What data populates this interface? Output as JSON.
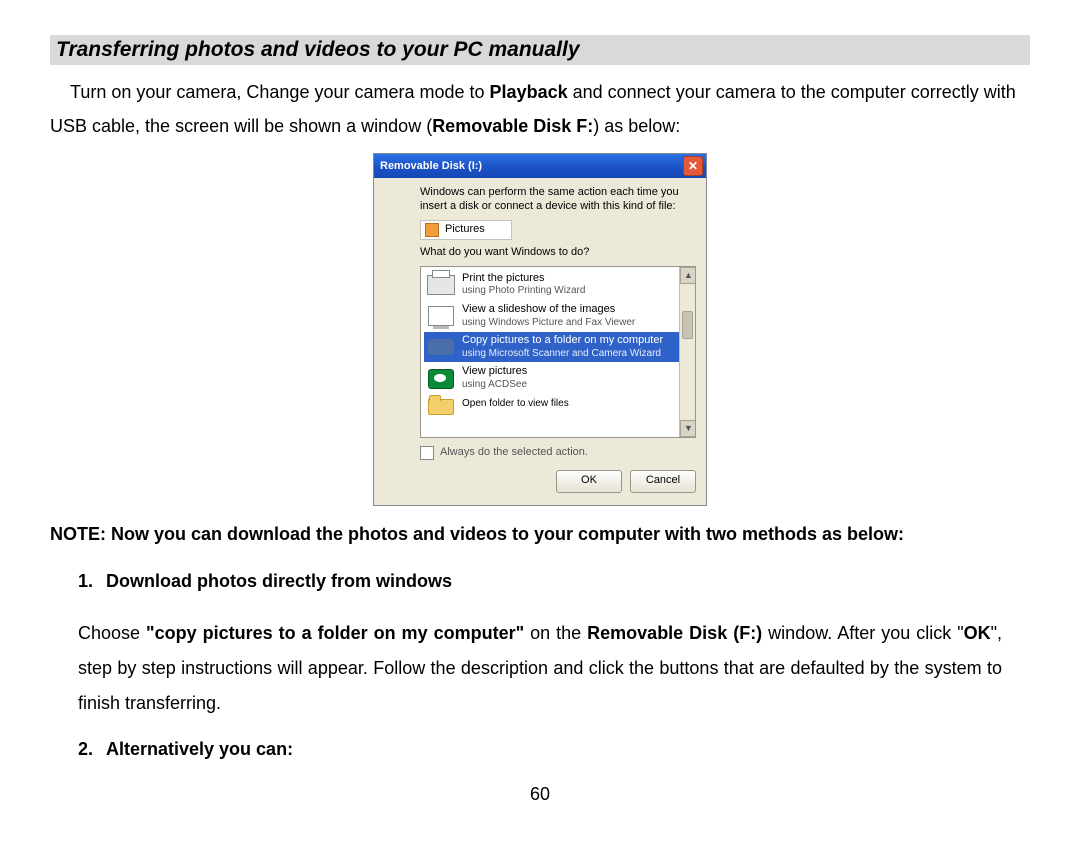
{
  "heading": "Transferring photos and videos to your PC manually",
  "intro": {
    "lead": "Turn on your camera, Change your camera mode to ",
    "bold1": "Playback",
    "mid": " and connect your camera to the computer correctly with USB cable, the screen will be shown a window (",
    "bold2": "Removable Disk F:",
    "tail": ") as below:"
  },
  "dialog": {
    "title": "Removable Disk (I:)",
    "close": "✕",
    "intro": "Windows can perform the same action each time you insert a disk or connect a device with this kind of file:",
    "pictures_label": "Pictures",
    "question": "What do you want Windows to do?",
    "options": [
      {
        "title": "Print the pictures",
        "sub": "using Photo Printing Wizard",
        "icon": "printer",
        "selected": false
      },
      {
        "title": "View a slideshow of the images",
        "sub": "using Windows Picture and Fax Viewer",
        "icon": "screen",
        "selected": false
      },
      {
        "title": "Copy pictures to a folder on my computer",
        "sub": "using Microsoft Scanner and Camera Wizard",
        "icon": "camera",
        "selected": true
      },
      {
        "title": "View pictures",
        "sub": "using ACDSee",
        "icon": "eye",
        "selected": false
      }
    ],
    "folder_option": "Open folder to view files",
    "always": "Always do the selected action.",
    "ok": "OK",
    "cancel": "Cancel"
  },
  "note": "NOTE: Now you can download the photos and videos to your computer with two methods as below:",
  "item1": {
    "num": "1.",
    "text": "Download photos directly from windows"
  },
  "para1": {
    "pre": "Choose ",
    "q1": "\"copy pictures to a folder on my computer\"",
    "mid1": " on the ",
    "b1": "Removable Disk (F:)",
    "mid2": " window.    After you click \"",
    "b2": "OK",
    "post": "\", step by step instructions will appear. Follow the description and click the buttons that are defaulted by the system to finish transferring."
  },
  "item2": {
    "num": "2.",
    "text": "Alternatively you can:"
  },
  "page_number": "60"
}
